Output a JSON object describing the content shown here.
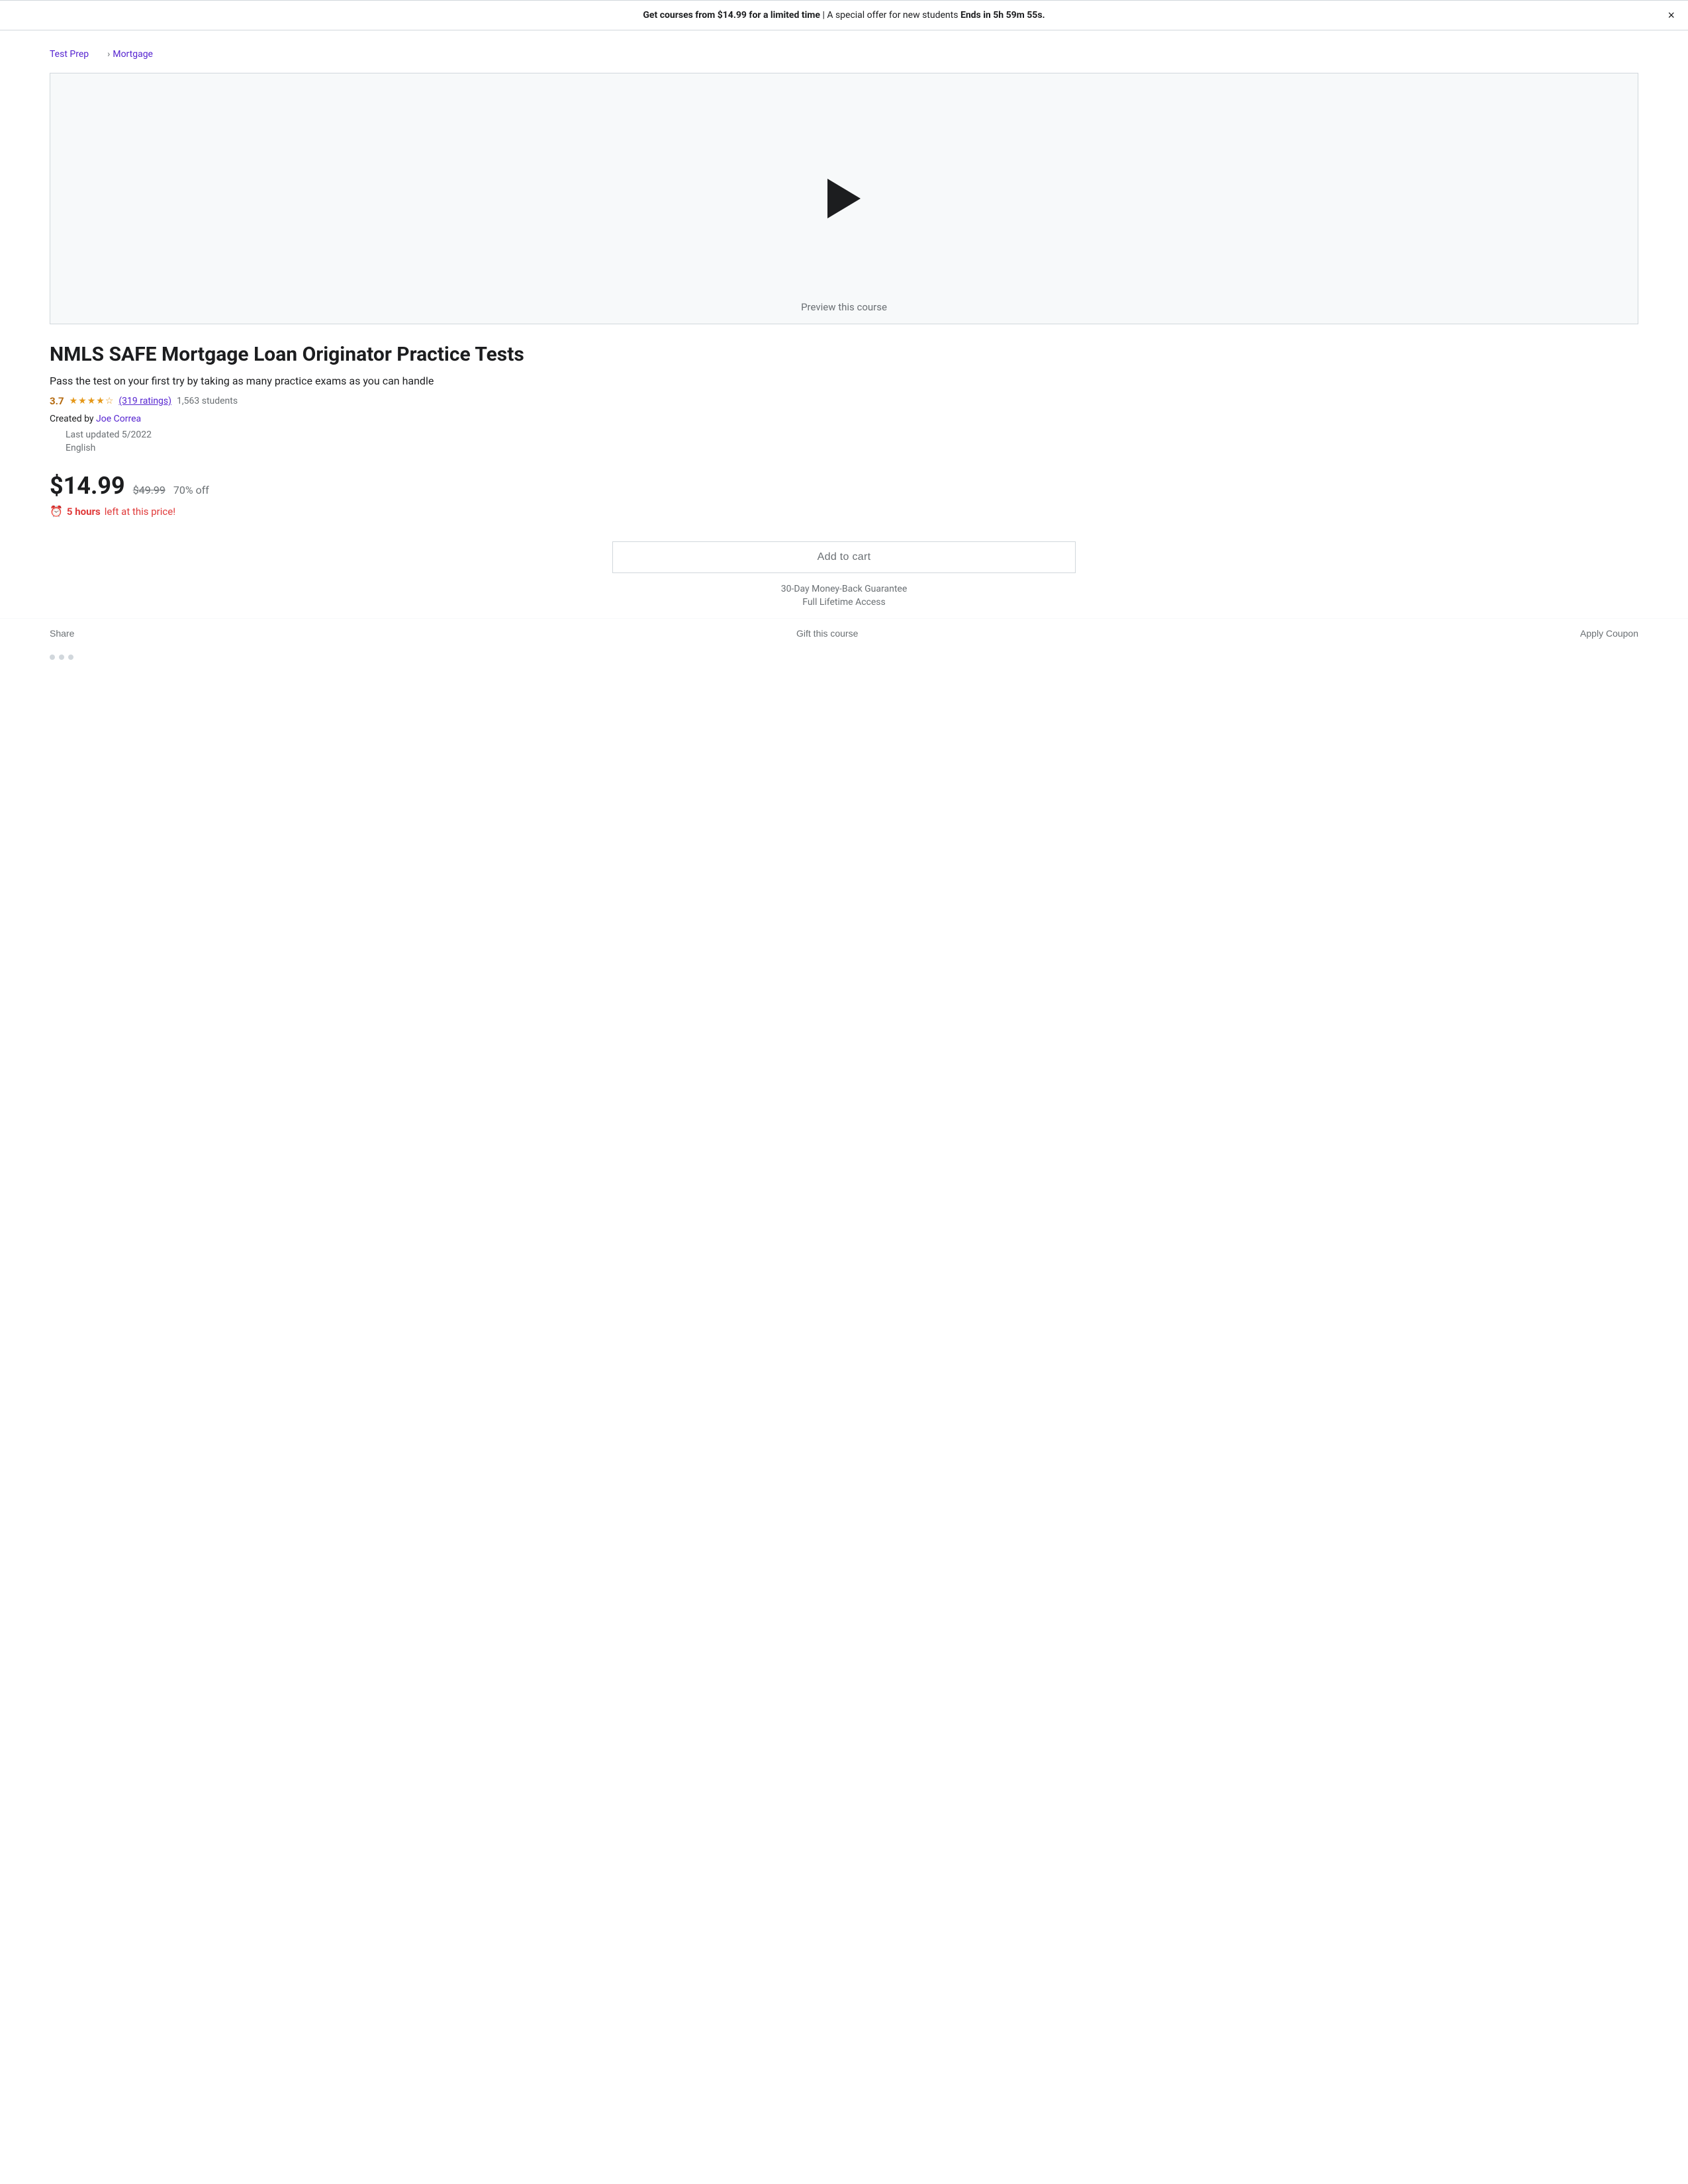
{
  "banner": {
    "text_start": "Get courses from $14.99 for a limited time",
    "text_middle": " | A special offer for new students ",
    "text_end": "Ends in 5h 59m 55s.",
    "close_label": "×"
  },
  "breadcrumb": {
    "items": [
      {
        "label": "Test Prep",
        "active": true
      },
      {
        "label": "Mortgage",
        "active": true
      }
    ]
  },
  "video": {
    "preview_label": "Preview this course"
  },
  "course": {
    "title": "NMLS SAFE Mortgage Loan Originator Practice Tests",
    "subtitle": "Pass the test on your first try by taking as many practice exams as you can handle",
    "rating": "3.7",
    "ratings_text": "(319 ratings)",
    "students": "1,563 students",
    "created_by_label": "Created by",
    "instructor": "Joe Correa",
    "last_updated_label": "Last updated 5/2022",
    "language": "English"
  },
  "pricing": {
    "current_price": "$14.99",
    "original_price": "$49.99",
    "discount": "70% off",
    "urgency_text": "5 hours",
    "urgency_suffix": "left at this price!"
  },
  "cart": {
    "add_to_cart_label": "Add to cart",
    "guarantee": "30-Day Money-Back Guarantee",
    "lifetime_access": "Full Lifetime Access"
  },
  "actions": {
    "share": "Share",
    "gift": "Gift this course",
    "coupon": "Apply Coupon"
  }
}
